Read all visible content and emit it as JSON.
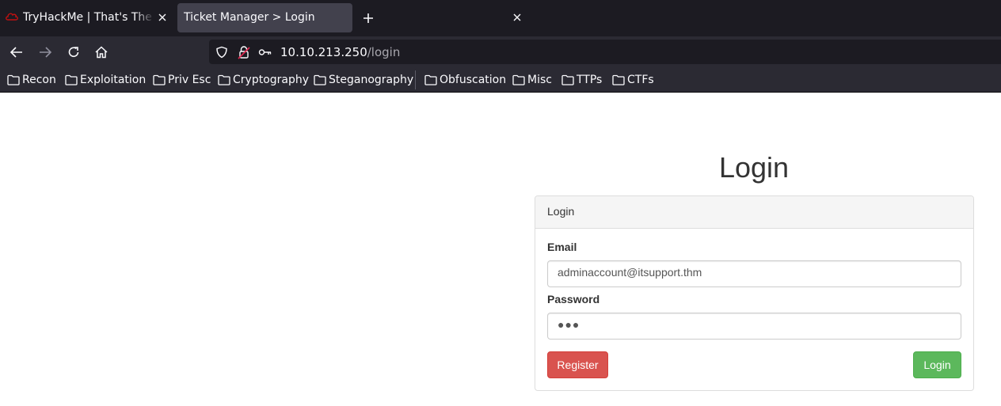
{
  "browser": {
    "tabs": [
      {
        "title": "TryHackMe | That's The Ticket",
        "active": false
      },
      {
        "title": "Ticket Manager > Login",
        "active": true
      }
    ],
    "url": {
      "host": "10.10.213.250",
      "path": "/login"
    },
    "bookmarks": [
      "Recon",
      "Exploitation",
      "Priv Esc",
      "Cryptography",
      "Steganography",
      "Obfuscation",
      "Misc",
      "TTPs",
      "CTFs"
    ]
  },
  "page": {
    "heading": "Login",
    "panel_title": "Login",
    "email": {
      "label": "Email",
      "value": "adminaccount@itsupport.thm"
    },
    "password": {
      "label": "Password",
      "value": "●●●"
    },
    "register_label": "Register",
    "login_label": "Login"
  },
  "colors": {
    "register": "#d9534f",
    "login": "#5cb85c",
    "tab_active": "#42414d",
    "chrome_bg": "#2b2a33"
  },
  "icons": [
    "tryhackme-favicon",
    "close-icon",
    "plus-icon",
    "back-arrow-icon",
    "forward-arrow-icon",
    "reload-icon",
    "home-icon",
    "shield-icon",
    "insecure-lock-icon",
    "key-icon",
    "folder-icon"
  ]
}
